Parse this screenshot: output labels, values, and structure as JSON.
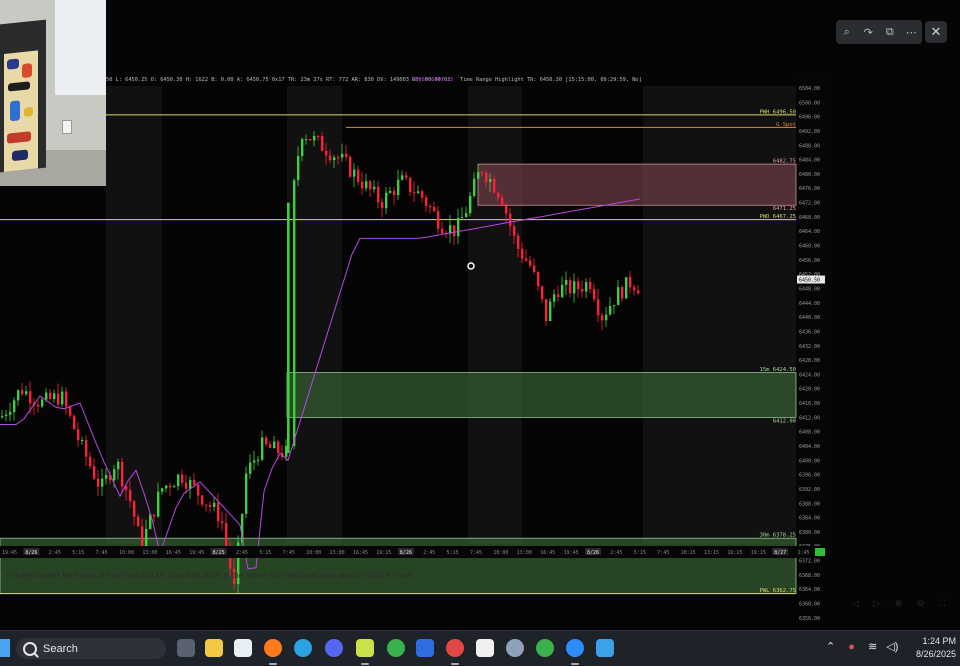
{
  "window": {
    "title": "",
    "close_label": "✕"
  },
  "overlay_toolbar": {
    "icons": [
      "zoom-icon",
      "share-icon",
      "external-link-icon",
      "more-icon"
    ],
    "glyphs": [
      "⌕",
      "↷",
      "⧉",
      "⋯"
    ]
  },
  "status_line": {
    "stats": "50 L: 6450.25 O: 6450.30 H: 1622 B: 0.00 A: 6450.75 0x17 TR: 23m 37s RT: 772 AR: 830 DV: 149003 DD: 00:00:01",
    "highlight": "15981 6447.25",
    "range": "Time Range Highlight  TR: 6450.30  [15:15:00, 09:29:59, No]"
  },
  "levels": [
    {
      "name": "PWH",
      "label": "PWH 6496.50",
      "price": 6496.5,
      "color": "#d8d86a"
    },
    {
      "name": "gap",
      "label": "G Spot",
      "price": 6493.0,
      "color": "#d98a3d"
    },
    {
      "name": "zone-top",
      "label": "6482.75",
      "price": 6482.75,
      "color": "#e0a0a8"
    },
    {
      "name": "zone-bottom",
      "label": "6471.25",
      "price": 6471.25,
      "color": "#e0a0a8"
    },
    {
      "name": "PWO",
      "label": "PWO 6467.25",
      "price": 6467.25,
      "color": "#d8d86a"
    },
    {
      "name": "15m-top",
      "label": "15m 6424.50",
      "price": 6424.5,
      "color": "#a8d8a0"
    },
    {
      "name": "15m-bottom",
      "label": "6412.00",
      "price": 6412.0,
      "color": "#a8d8a0"
    },
    {
      "name": "30m-top",
      "label": "30m 6378.25",
      "price": 6378.25,
      "color": "#a8d8a0"
    },
    {
      "name": "PWL",
      "label": "PWL 6362.75",
      "price": 6362.75,
      "color": "#d8d86a"
    }
  ],
  "price_scale": {
    "ticks": [
      "6504.00",
      "6500.00",
      "6496.00",
      "6492.00",
      "6488.00",
      "6484.00",
      "6480.00",
      "6476.00",
      "6472.00",
      "6468.00",
      "6464.00",
      "6460.00",
      "6456.00",
      "6452.00",
      "6448.00",
      "6444.00",
      "6440.00",
      "6436.00",
      "6432.00",
      "6428.00",
      "6424.00",
      "6420.00",
      "6416.00",
      "6412.00",
      "6408.00",
      "6404.00",
      "6400.00",
      "6396.00",
      "6392.00",
      "6388.00",
      "6384.00",
      "6380.00",
      "6376.00",
      "6372.00",
      "6368.00",
      "6364.00",
      "6360.00",
      "6356.00"
    ],
    "current_price": "6450.50"
  },
  "time_axis": {
    "labels": [
      "19:45",
      "8/26",
      "2:45",
      "5:15",
      "7:45",
      "10:00",
      "13:00",
      "16:45",
      "19:45",
      "8/25",
      "2:45",
      "5:15",
      "7:45",
      "10:00",
      "13:00",
      "16:45",
      "19:15",
      "8/26",
      "2:45",
      "5:15",
      "7:45",
      "10:00",
      "13:00",
      "16:45",
      "19:45",
      "8/26",
      "2:45",
      "5:15",
      "7:45",
      "10:15",
      "13:15",
      "16:15",
      "19:15",
      "8/27",
      "2:45"
    ]
  },
  "taskbar": {
    "search_placeholder": "Search",
    "apps": [
      "task-view-icon",
      "file-explorer-icon",
      "calendar-icon",
      "firefox-icon",
      "telegram-icon",
      "discord-icon",
      "trading-app-icon",
      "shield-app-icon",
      "store-icon",
      "chrome-icon",
      "capcut-icon",
      "settings-icon",
      "shield-green-icon",
      "zoom-icon",
      "photos-icon"
    ],
    "time": "1:24 PM",
    "date": "8/26/2025"
  },
  "caption": "Futures traders take note of this level and set up a limit order in the recent 15m demand zone area to catch a move"
}
